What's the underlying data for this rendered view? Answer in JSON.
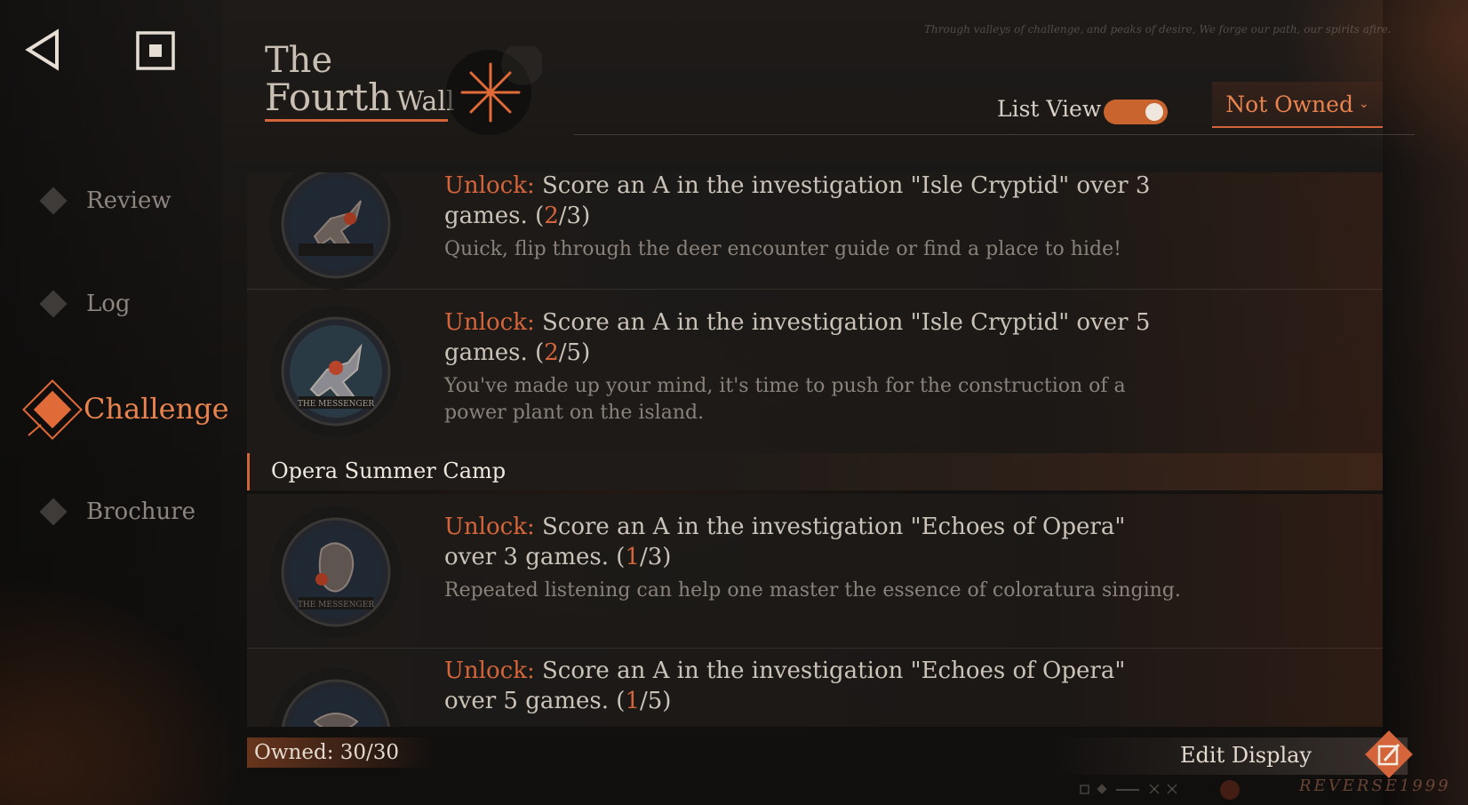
{
  "header": {
    "title_line1": "The",
    "title_line2": "Fourth",
    "title_line3": "Wall",
    "tagline": "Through valleys of challenge, and peaks of desire, We forge our path, our spirits afire."
  },
  "controls": {
    "list_view_label": "List View",
    "list_view_on": true,
    "filter_label": "Not Owned"
  },
  "sidebar": {
    "items": [
      {
        "label": "Review",
        "active": false
      },
      {
        "label": "Log",
        "active": false
      },
      {
        "label": "Challenge",
        "active": true
      },
      {
        "label": "Brochure",
        "active": false
      }
    ]
  },
  "list": {
    "rows": [
      {
        "unlock_keyword": "Unlock:",
        "requirement": "Score an A in the investigation \"Isle Cryptid\" over 3 games.",
        "progress_open": "(",
        "progress_current": "2",
        "progress_total": "/3)",
        "description": "Quick, flip through the deer encounter guide or find a place to hide!",
        "badge_label": "THE MESSENGER"
      },
      {
        "unlock_keyword": "Unlock:",
        "requirement": "Score an A in the investigation \"Isle Cryptid\" over 5 games.",
        "progress_open": "(",
        "progress_current": "2",
        "progress_total": "/5)",
        "description": "You've made up your mind, it's time to push for the construction of a power plant on the island.",
        "badge_label": "THE MESSENGER"
      },
      {
        "unlock_keyword": "Unlock:",
        "requirement": "Score an A in the investigation \"Echoes of Opera\" over 3 games.",
        "progress_open": "(",
        "progress_current": "1",
        "progress_total": "/3)",
        "description": "Repeated listening can help one master the essence of coloratura singing.",
        "badge_label": "THE MESSENGER"
      },
      {
        "unlock_keyword": "Unlock:",
        "requirement": "Score an A in the investigation \"Echoes of Opera\" over 5 games.",
        "progress_open": "(",
        "progress_current": "1",
        "progress_total": "/5)",
        "description": "",
        "badge_label": ""
      }
    ],
    "section_title": "Opera Summer Camp"
  },
  "footer": {
    "owned": "Owned: 30/30",
    "edit_display": "Edit Display",
    "logo": "REVERSE1999"
  },
  "colors": {
    "accent": "#d4653a",
    "accent_light": "#e8834f",
    "text": "#cbc3b8",
    "muted": "#8a827a"
  }
}
